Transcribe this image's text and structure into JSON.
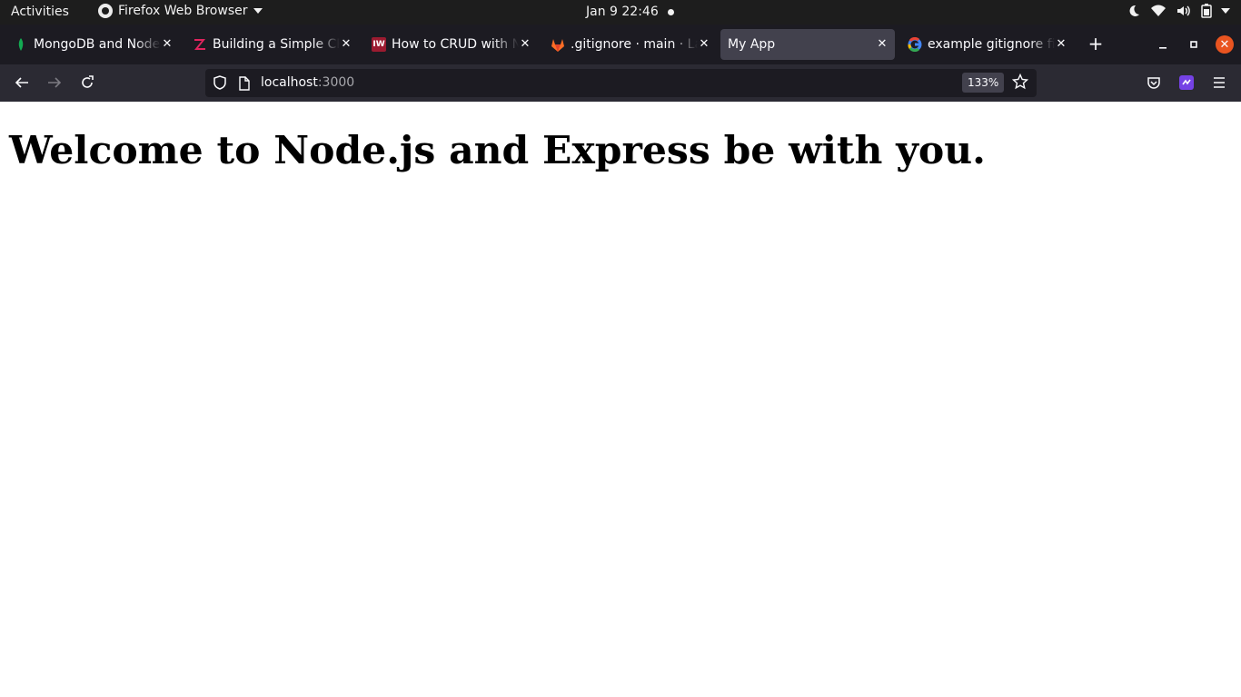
{
  "system": {
    "activities_label": "Activities",
    "app_menu_label": "Firefox Web Browser",
    "clock": "Jan 9  22:46",
    "status_icons": [
      "moon-icon",
      "wifi-icon",
      "volume-icon",
      "battery-icon",
      "system-menu-caret"
    ]
  },
  "browser": {
    "tabs": [
      {
        "title": "MongoDB and Node.js",
        "favicon": "mongodb-leaf-icon",
        "active": false
      },
      {
        "title": "Building a Simple CRUD",
        "favicon": "zeolearn-z-icon",
        "active": false
      },
      {
        "title": "How to CRUD with Node",
        "favicon": "iw-icon",
        "favicon_text": "IW",
        "active": false
      },
      {
        "title": ".gitignore · main · Lall",
        "favicon": "gitlab-icon",
        "active": false
      },
      {
        "title": "My App",
        "favicon": "",
        "active": true
      },
      {
        "title": "example gitignore file",
        "favicon": "google-icon",
        "active": false
      }
    ],
    "address": {
      "host": "localhost",
      "port": ":3000",
      "zoom": "133%"
    },
    "colors": {
      "tab_strip": "#1c1b22",
      "toolbar": "#2b2a33",
      "active_tab": "#42414d",
      "window_close": "#e95420"
    }
  },
  "page": {
    "heading": "Welcome to Node.js and Express be with you."
  }
}
